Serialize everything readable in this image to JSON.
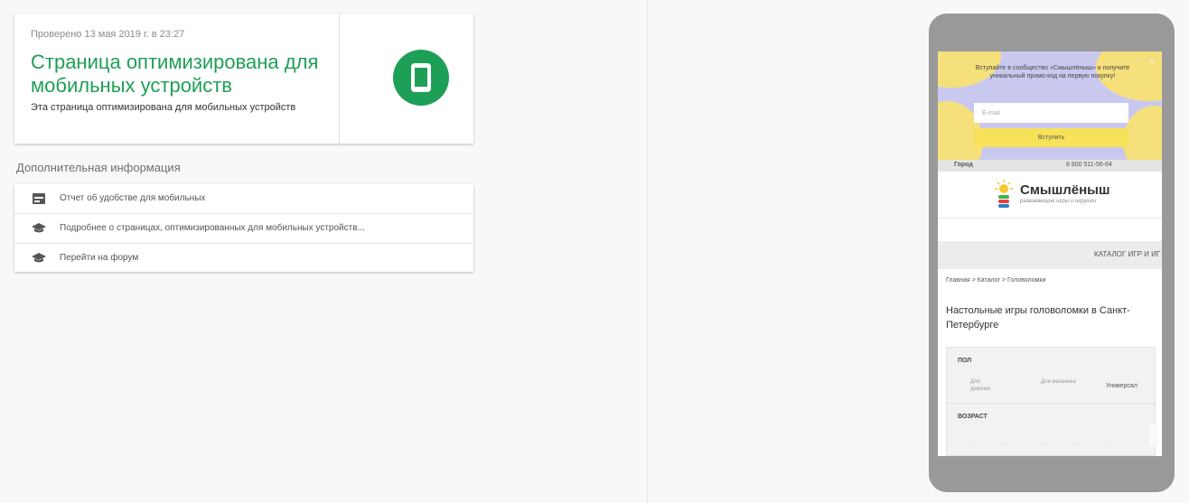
{
  "result": {
    "checked_date": "Проверено 13 мая 2019 г. в 23:27",
    "title": "Страница оптимизирована для мобильных устройств",
    "subtitle": "Эта страница оптимизирована для мобильных устройств"
  },
  "additional_info": {
    "title": "Дополнительная информация",
    "items": [
      {
        "label": "Отчет об удобстве для мобильных",
        "icon": "report-icon"
      },
      {
        "label": "Подробнее о страницах, оптимизированных для мобильных устройств...",
        "icon": "school-cap-icon"
      },
      {
        "label": "Перейти на форум",
        "icon": "school-cap-icon"
      }
    ]
  },
  "preview": {
    "promo": {
      "text": "Вступайте в сообщество «Смышлёныш» и получите уникальный промо-код на первую покупку!",
      "close": "×",
      "email_placeholder": "E-mail",
      "button": "Вступить"
    },
    "city": "Город",
    "phone": "8 800 511-56-64",
    "logo_name": "Смышлёныш",
    "logo_tagline": "развивающие игры и игрушки",
    "catalog": "КАТАЛОГ ИГР И ИГ",
    "breadcrumbs": "Главная > Каталог > Головоломки",
    "heading": "Настольные игры головоломки в Санкт-Петербурге",
    "filter": {
      "gender_title": "ПОЛ",
      "gender_options": [
        "Для девочки",
        "Для мальчика",
        "Универсал"
      ],
      "age_title": "ВОЗРАСТ",
      "age_options": [
        "...",
        "...",
        "...",
        "...",
        "..."
      ]
    }
  },
  "colors": {
    "success_green": "#1e9f57",
    "phone_frame": "#999999",
    "promo_bg": "#c9c9f0",
    "promo_accent": "#f6e07b"
  }
}
